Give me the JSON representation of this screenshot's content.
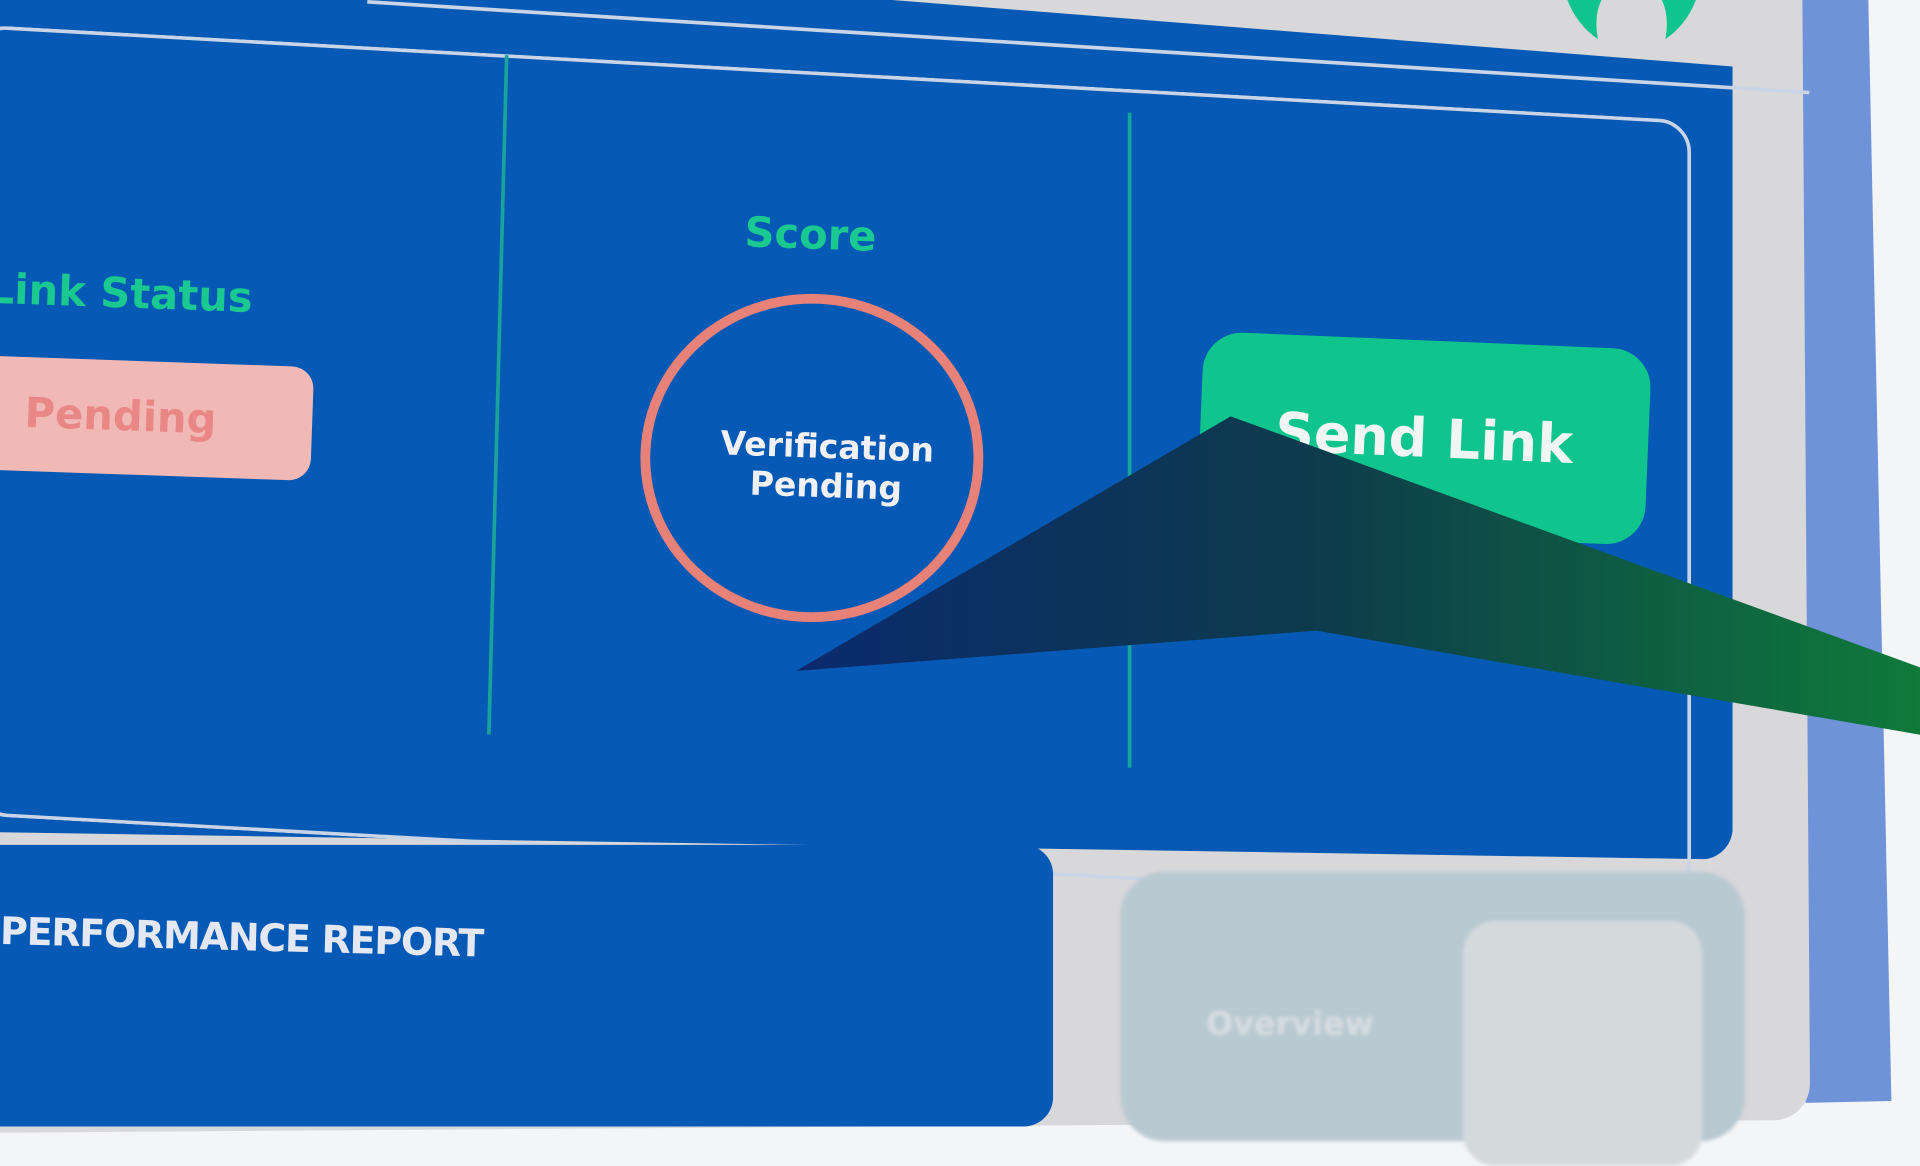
{
  "link_status": {
    "label": "Link Status",
    "value": "Pending"
  },
  "score": {
    "label": "Score",
    "value": "Verification Pending"
  },
  "actions": {
    "send_link": "Send Link"
  },
  "performance": {
    "title": "PERFORMANCE REPORT"
  },
  "overview": {
    "label": "Overview"
  },
  "colors": {
    "panel": "#0659b4",
    "accent": "#19c98f",
    "pending": "#e88178",
    "background": "#d8d7da"
  }
}
